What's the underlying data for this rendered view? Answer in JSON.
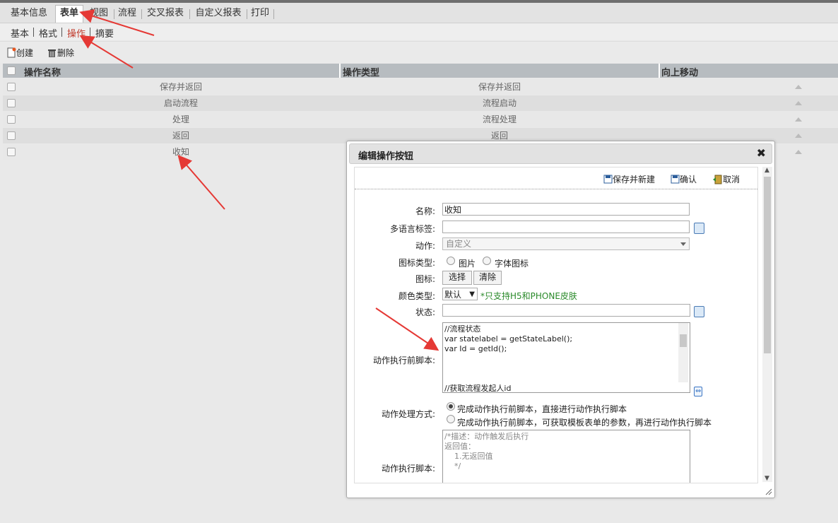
{
  "tabs": [
    "基本信息",
    "表单",
    "视图",
    "流程",
    "交叉报表",
    "自定义报表",
    "打印"
  ],
  "subtabs": [
    "基本",
    "格式",
    "操作",
    "摘要"
  ],
  "toolbar": {
    "create": "创建",
    "delete": "删除"
  },
  "grid": {
    "headers": [
      "操作名称",
      "操作类型",
      "向上移动"
    ],
    "rows": [
      {
        "name": "保存并返回",
        "type": "保存并返回"
      },
      {
        "name": "启动流程",
        "type": "流程启动"
      },
      {
        "name": "处理",
        "type": "流程处理"
      },
      {
        "name": "返回",
        "type": "返回"
      },
      {
        "name": "收知",
        "type": ""
      }
    ]
  },
  "dialog": {
    "title": "编辑操作按钮",
    "close": "✖",
    "buttons": {
      "save_new": "保存并新建",
      "confirm": "确认",
      "cancel": "取消"
    },
    "fields": {
      "name_label": "名称:",
      "name_value": "收知",
      "i18n_label": "多语言标签:",
      "i18n_value": "",
      "action_label": "动作:",
      "action_value": "自定义",
      "icon_type_label": "图标类型:",
      "icon_type_opt1": "图片",
      "icon_type_opt2": "字体图标",
      "icon_label": "图标:",
      "icon_select": "选择",
      "icon_clear": "清除",
      "color_type_label": "颜色类型:",
      "color_type_value": "默认",
      "color_type_note": "*只支持H5和PHONE皮肤",
      "state_label": "状态:",
      "state_value": "",
      "pre_script_label": "动作执行前脚本:",
      "pre_script": "//流程状态\nvar statelabel = getStateLabel();\nvar Id = getId();\n\n\n\n//获取流程发起人id",
      "handle_label": "动作处理方式:",
      "handle_opt1": "完成动作执行前脚本，直接进行动作执行脚本",
      "handle_opt2": "完成动作执行前脚本，可获取模板表单的参数，再进行动作执行脚本",
      "exec_script_label": "动作执行脚本:",
      "exec_script": "/*描述：动作触发后执行\n返回值：\n    1.无返回值\n    */"
    }
  }
}
